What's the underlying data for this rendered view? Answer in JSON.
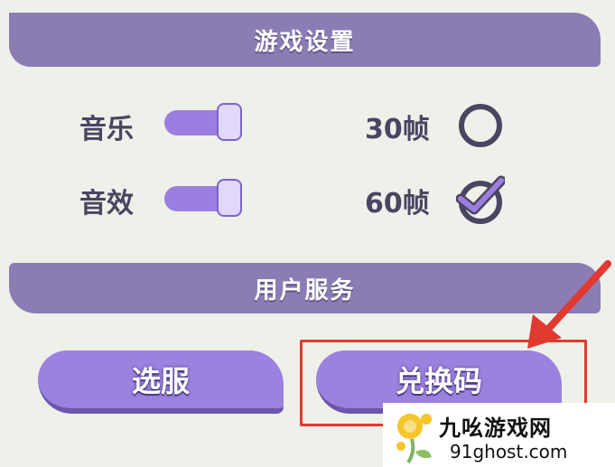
{
  "game_settings": {
    "title": "游戏设置",
    "music_label": "音乐",
    "sfx_label": "音效",
    "music_on": true,
    "sfx_on": true,
    "fps_30_label": "30帧",
    "fps_60_label": "60帧",
    "fps_selected": "60帧"
  },
  "user_service": {
    "title": "用户服务",
    "select_server_label": "选服",
    "redeem_code_label": "兑换码"
  },
  "colors": {
    "banner": "#8b7db3",
    "button": "#9b82de",
    "highlight": "#e03a30"
  },
  "watermark": {
    "title": "九吆游戏网",
    "url": "91ghost.com"
  }
}
